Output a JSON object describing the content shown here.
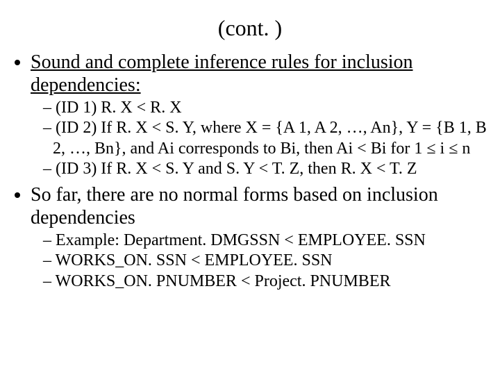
{
  "title": "(cont. )",
  "bullets": [
    {
      "text": "Sound and complete inference rules for inclusion dependencies:",
      "underline": true,
      "sub": [
        "(ID 1) R. X < R. X",
        "(ID 2) If R. X < S. Y, where X = {A 1, A 2, …, An}, Y = {B 1, B 2, …, Bn}, and Ai corresponds to Bi, then Ai < Bi for 1 ≤ i ≤ n",
        "(ID 3) If R. X < S. Y and S. Y < T. Z, then R. X < T. Z"
      ]
    },
    {
      "text": "So far, there are no normal forms based on inclusion dependencies",
      "underline": false,
      "sub": [
        "Example: Department. DMGSSN < EMPLOYEE. SSN",
        "WORKS_ON. SSN < EMPLOYEE. SSN",
        "WORKS_ON. PNUMBER < Project. PNUMBER"
      ]
    }
  ]
}
